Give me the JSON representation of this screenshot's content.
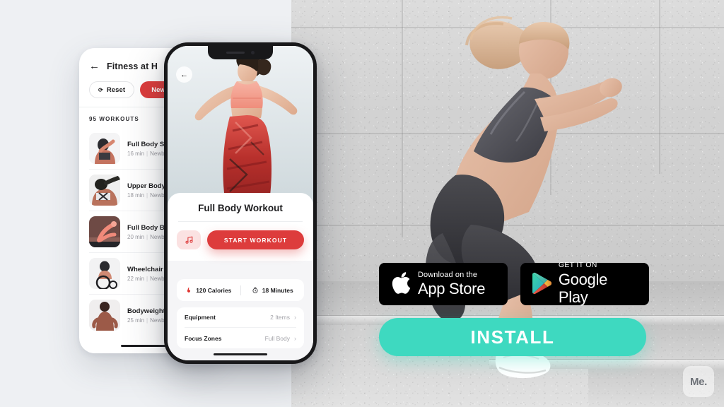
{
  "colors": {
    "brand_red": "#dd3c3c",
    "install_teal": "#3ed9c0",
    "page_background": "#eef0f3",
    "badge_black": "#000000",
    "card_white": "#ffffff"
  },
  "left_phone": {
    "back_icon": "back-arrow-icon",
    "title": "Fitness at H",
    "chips": [
      {
        "label": "Reset",
        "icon": "reset-icon",
        "style": "outline"
      },
      {
        "label": "Newbie",
        "icon": "",
        "style": "filled-red"
      }
    ],
    "section_count_label": "95 WORKOUTS",
    "workouts": [
      {
        "name": "Full Body Set",
        "duration": "16 min",
        "level": "Newb"
      },
      {
        "name": "Upper Body E",
        "duration": "18 min",
        "level": "Newb"
      },
      {
        "name": "Full Body Burn",
        "duration": "20 min",
        "level": "Newb"
      },
      {
        "name": "Wheelchair Ca",
        "duration": "22 min",
        "level": "Newb"
      },
      {
        "name": "Bodyweight W",
        "duration": "25 min",
        "level": "Newb"
      }
    ],
    "separator": "|"
  },
  "right_phone": {
    "back_icon": "back-arrow-icon",
    "workout_title": "Full Body Workout",
    "music_icon": "music-note-icon",
    "start_button_label": "START WORKOUT",
    "stats": [
      {
        "icon": "flame-icon",
        "value": "120 Calories"
      },
      {
        "icon": "stopwatch-icon",
        "value": "18 Minutes"
      }
    ],
    "detail_rows": [
      {
        "label": "Equipment",
        "value": "2 Items",
        "chevron": "chevron-right-icon"
      },
      {
        "label": "Focus Zones",
        "value": "Full Body",
        "chevron": "chevron-right-icon"
      }
    ]
  },
  "store_badges": [
    {
      "id": "app-store",
      "icon": "apple-logo-icon",
      "line1": "Download on the",
      "line2": "App Store"
    },
    {
      "id": "google-play",
      "icon": "google-play-logo-icon",
      "line1": "GET IT ON",
      "line2": "Google Play"
    }
  ],
  "install_button": {
    "label": "INSTALL"
  },
  "watermark": {
    "label": "Me."
  }
}
